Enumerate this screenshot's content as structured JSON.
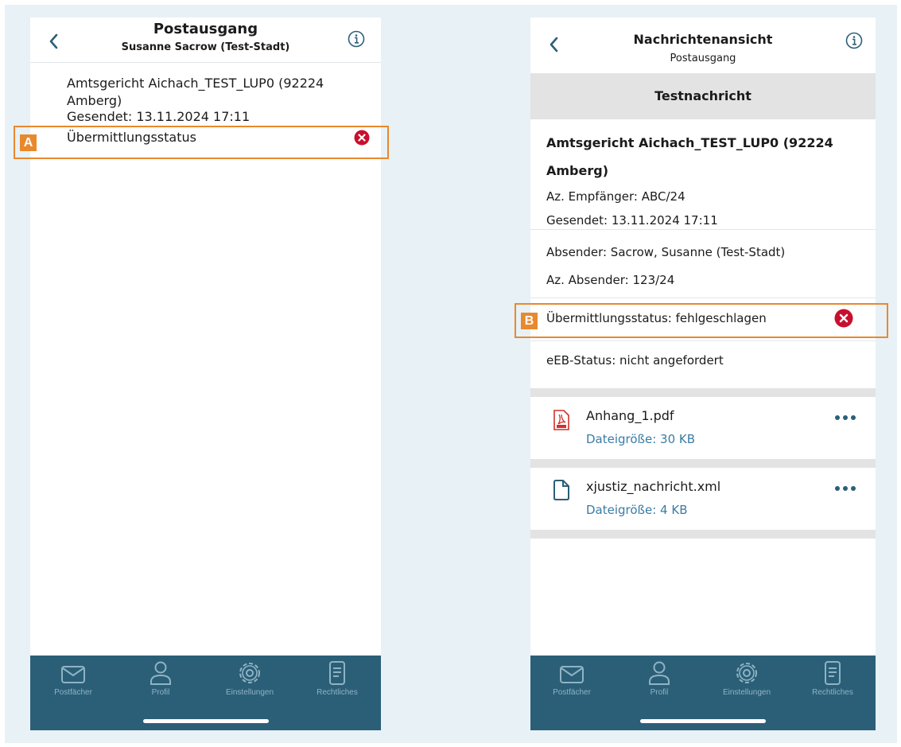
{
  "left_screen": {
    "header": {
      "title": "Postausgang",
      "subtitle": "Susanne Sacrow (Test-Stadt)"
    },
    "message": {
      "recipient": "Amtsgericht Aichach_TEST_LUP0 (92224 Amberg)",
      "sent": "Gesendet: 13.11.2024 17:11",
      "status_label": "Übermittlungsstatus",
      "status_icon": "error-x-icon"
    },
    "marker": "A"
  },
  "right_screen": {
    "header": {
      "title": "Nachrichtenansicht",
      "subtitle": "Postausgang"
    },
    "subject": "Testnachricht",
    "recipient": "Amtsgericht Aichach_TEST_LUP0 (92224 Amberg)",
    "recipient_ref": "Az. Empfänger: ABC/24",
    "sent": "Gesendet: 13.11.2024 17:11",
    "sender": "Absender: Sacrow, Susanne (Test-Stadt)",
    "sender_ref": "Az. Absender: 123/24",
    "status": "Übermittlungsstatus: fehlgeschlagen",
    "eeb_status": "eEB-Status: nicht angefordert",
    "marker": "B",
    "attachments": [
      {
        "name": "Anhang_1.pdf",
        "size": "Dateigröße: 30 KB",
        "icon": "pdf-file-icon"
      },
      {
        "name": "xjustiz_nachricht.xml",
        "size": "Dateigröße: 4 KB",
        "icon": "file-icon"
      }
    ]
  },
  "tabbar": {
    "items": [
      {
        "label": "Postfächer",
        "icon": "mail-icon"
      },
      {
        "label": "Profil",
        "icon": "user-icon"
      },
      {
        "label": "Einstellungen",
        "icon": "gear-icon"
      },
      {
        "label": "Rechtliches",
        "icon": "document-icon"
      }
    ]
  },
  "colors": {
    "tabbar": "#2b5f78",
    "accent_blue": "#3a7ca5",
    "highlight_orange": "#e8892e",
    "error_red": "#c8102e",
    "frame": "#e8f1f5"
  }
}
